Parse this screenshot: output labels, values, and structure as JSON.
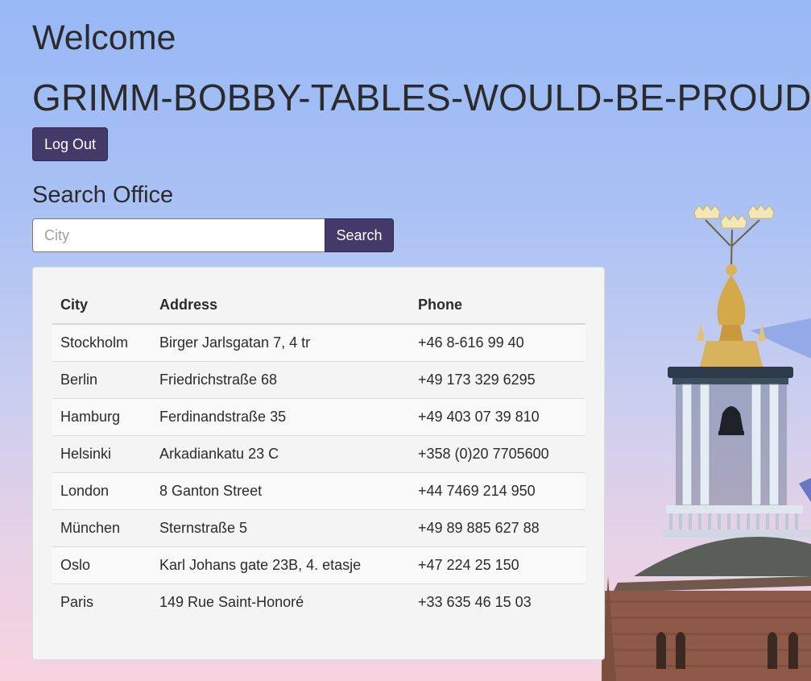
{
  "header": {
    "welcome": "Welcome",
    "username": "GRIMM-BOBBY-TABLES-WOULD-BE-PROUD",
    "logout_label": "Log Out"
  },
  "search": {
    "title": "Search Office",
    "placeholder": "City",
    "value": "",
    "button_label": "Search"
  },
  "table": {
    "headers": [
      "City",
      "Address",
      "Phone"
    ],
    "rows": [
      [
        "Stockholm",
        "Birger Jarlsgatan 7, 4 tr",
        "+46 8-616 99 40"
      ],
      [
        "Berlin",
        "Friedrichstraße 68",
        "+49 173 329 6295"
      ],
      [
        "Hamburg",
        "Ferdinandstraße 35",
        "+49 403 07 39 810"
      ],
      [
        "Helsinki",
        "Arkadiankatu 23 C",
        "+358 (0)20 7705600"
      ],
      [
        "London",
        "8 Ganton Street",
        "+44 7469 214 950"
      ],
      [
        "München",
        "Sternstraße 5",
        "+49 89 885 627 88"
      ],
      [
        "Oslo",
        "Karl Johans gate 23B, 4. etasje",
        "+47 224 25 150"
      ],
      [
        "Paris",
        "149 Rue Saint-Honoré",
        "+33 635 46 15 03"
      ]
    ]
  },
  "colors": {
    "button": "#443a6a",
    "panel": "#f4f4f4"
  },
  "background": {
    "image": "city-hall-tower-icon"
  }
}
